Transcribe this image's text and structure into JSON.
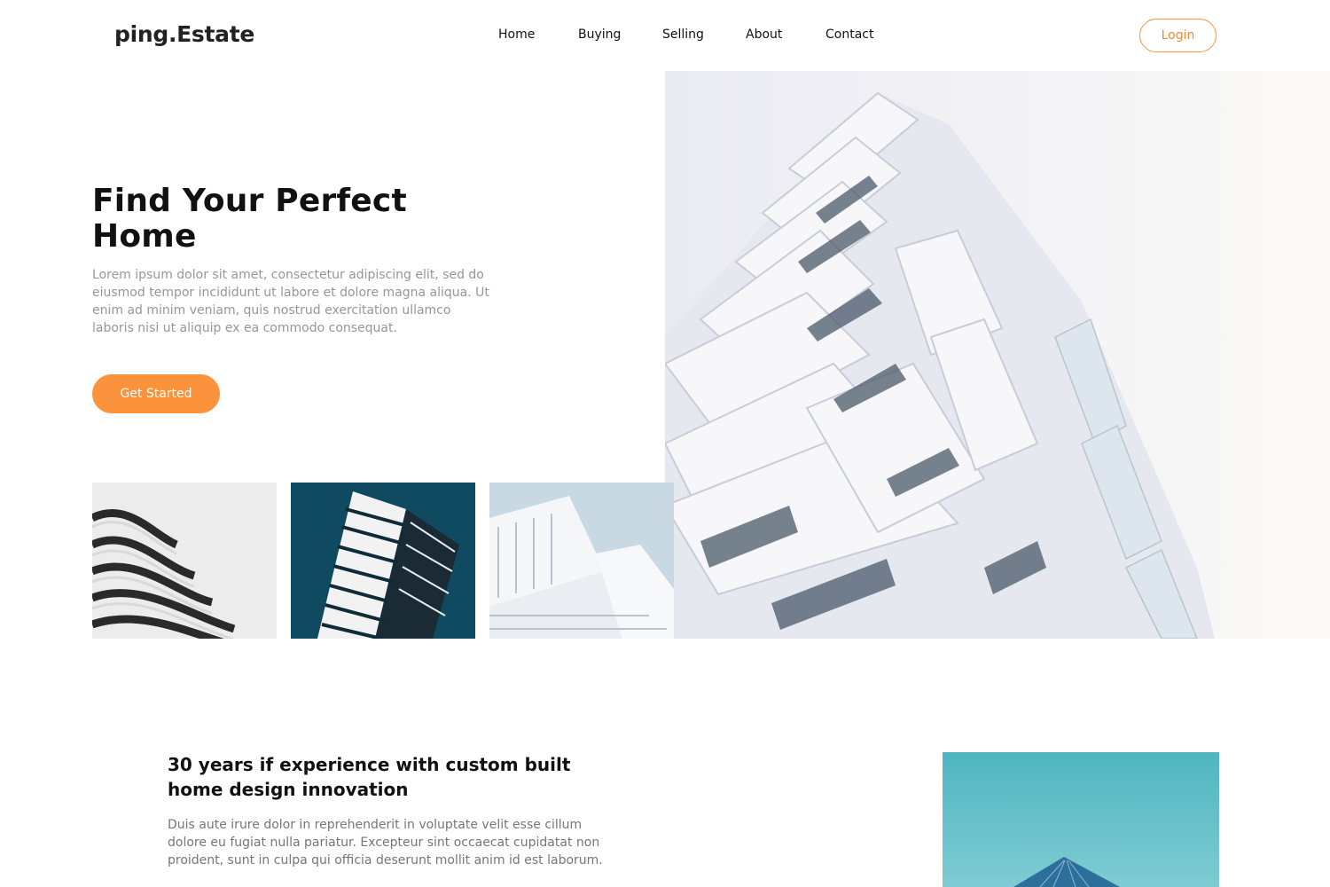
{
  "header": {
    "logo": "ping.Estate",
    "nav": [
      "Home",
      "Buying",
      "Selling",
      "About",
      "Contact"
    ],
    "login_label": "Login"
  },
  "hero": {
    "title_line1": "Find Your Perfect",
    "title_line2": "Home",
    "text": "Lorem ipsum dolor sit amet, consectetur adipiscing elit, sed do eiusmod tempor incididunt ut labore et dolore magna aliqua. Ut enim ad minim veniam, quis nostrud exercitation ullamco laboris nisi ut aliquip ex ea commodo consequat.",
    "cta_label": "Get Started"
  },
  "section": {
    "title": "30 years if experience with custom built home design innovation",
    "text": "Duis aute irure dolor in reprehenderit in voluptate velit esse cillum dolore eu fugiat nulla pariatur. Excepteur sint occaecat cupidatat non proident, sunt in culpa qui officia deserunt mollit anim id est laborum."
  },
  "colors": {
    "accent": "#fb923c",
    "text_muted": "#9a9595",
    "heading": "#111111"
  }
}
